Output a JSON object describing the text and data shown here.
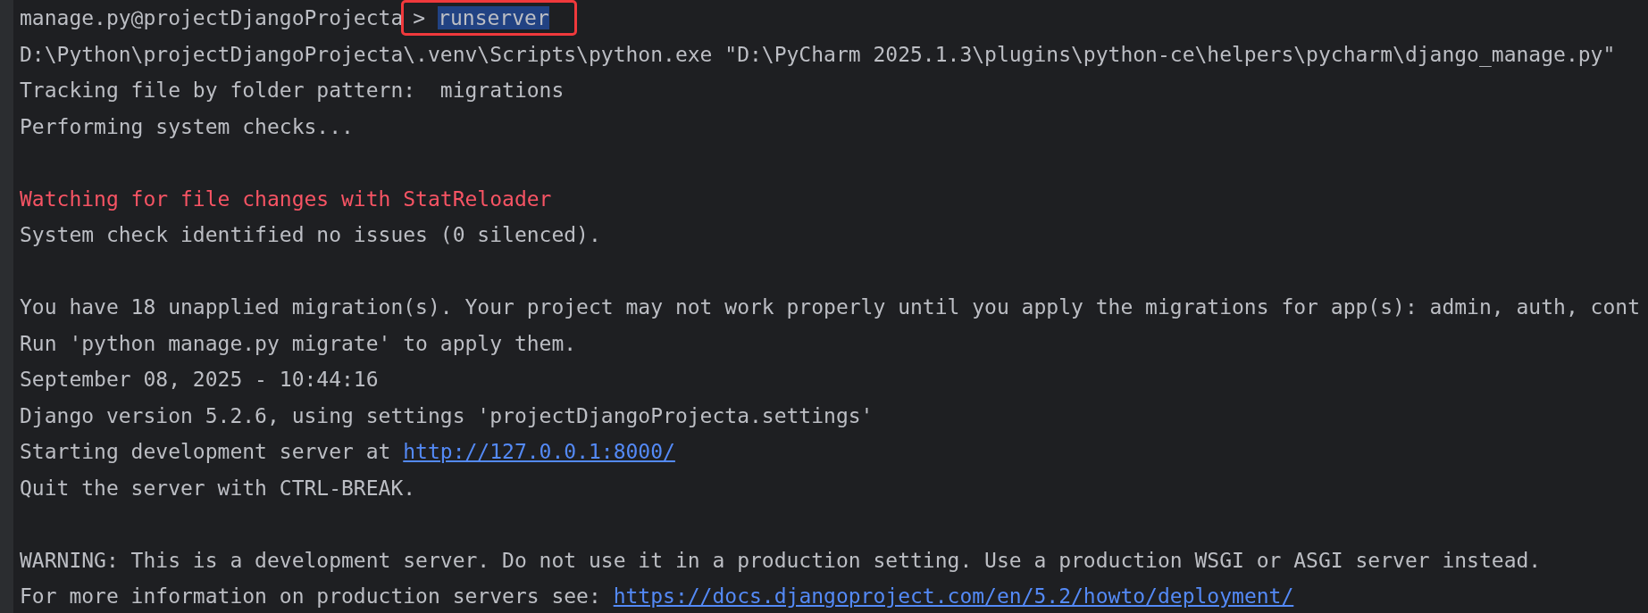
{
  "terminal": {
    "lines": [
      {
        "kind": "prompt",
        "prompt": "manage.py@projectDjangoProjecta",
        "arrow": ">",
        "command": "runserver",
        "command_selected": true,
        "outlined": true
      },
      {
        "kind": "text",
        "text": "D:\\Python\\projectDjangoProjecta\\.venv\\Scripts\\python.exe \"D:\\PyCharm 2025.1.3\\plugins\\python-ce\\helpers\\pycharm\\django_manage.py\""
      },
      {
        "kind": "text",
        "text": "Tracking file by folder pattern:  migrations"
      },
      {
        "kind": "text",
        "text": "Performing system checks..."
      },
      {
        "kind": "blank"
      },
      {
        "kind": "error",
        "text": "Watching for file changes with StatReloader"
      },
      {
        "kind": "text",
        "text": "System check identified no issues (0 silenced)."
      },
      {
        "kind": "blank"
      },
      {
        "kind": "text",
        "text": "You have 18 unapplied migration(s). Your project may not work properly until you apply the migrations for app(s): admin, auth, cont"
      },
      {
        "kind": "text",
        "text": "Run 'python manage.py migrate' to apply them."
      },
      {
        "kind": "text",
        "text": "September 08, 2025 - 10:44:16"
      },
      {
        "kind": "text",
        "text": "Django version 5.2.6, using settings 'projectDjangoProjecta.settings'"
      },
      {
        "kind": "link",
        "text": "Starting development server at ",
        "link": "http://127.0.0.1:8000/"
      },
      {
        "kind": "text",
        "text": "Quit the server with CTRL-BREAK."
      },
      {
        "kind": "blank"
      },
      {
        "kind": "text",
        "text": "WARNING: This is a development server. Do not use it in a production setting. Use a production WSGI or ASGI server instead."
      },
      {
        "kind": "link",
        "text": "For more information on production servers see: ",
        "link": "https://docs.djangoproject.com/en/5.2/howto/deployment/"
      }
    ]
  }
}
